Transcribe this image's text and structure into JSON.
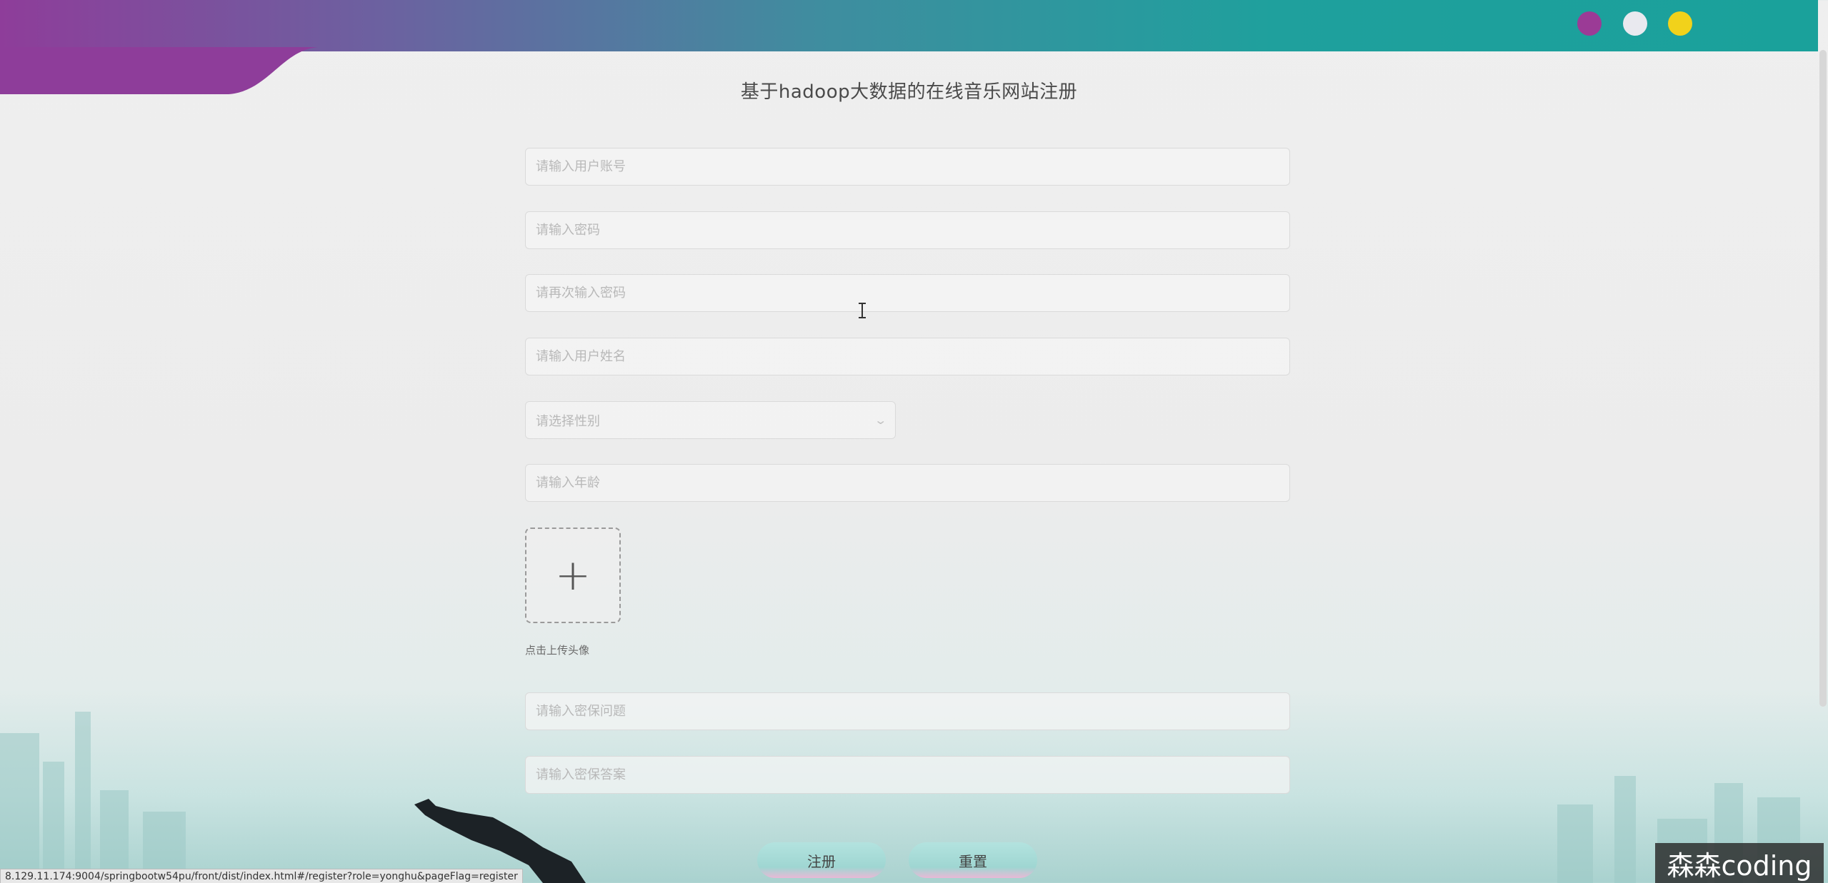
{
  "window": {
    "dots": [
      "purple-dot",
      "white-dot",
      "yellow-dot"
    ],
    "colors": {
      "purple": "#9b3b96",
      "white": "#e9e9ef",
      "yellow": "#f1d21b",
      "banner_start": "#8e3d9a",
      "banner_end": "#1aa19b"
    }
  },
  "page": {
    "title": "基于hadoop大数据的在线音乐网站注册"
  },
  "form": {
    "account_placeholder": "请输入用户账号",
    "password_placeholder": "请输入密码",
    "confirm_password_placeholder": "请再次输入密码",
    "name_placeholder": "请输入用户姓名",
    "gender_placeholder": "请选择性别",
    "age_placeholder": "请输入年龄",
    "avatar_label": "点击上传头像",
    "security_question_placeholder": "请输入密保问题",
    "security_answer_placeholder": "请输入密保答案"
  },
  "buttons": {
    "register": "注册",
    "reset": "重置"
  },
  "status_bar": {
    "url": "8.129.11.174:9004/springbootw54pu/front/dist/index.html#/register?role=yonghu&pageFlag=register"
  },
  "watermark": {
    "text": "森森coding"
  }
}
